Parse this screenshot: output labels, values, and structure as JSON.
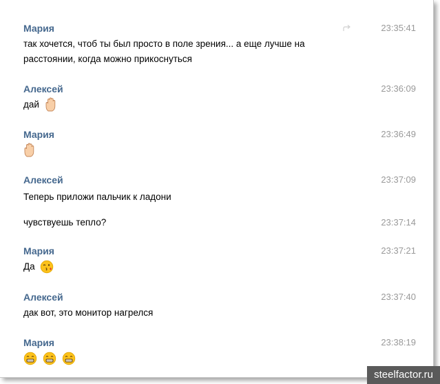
{
  "messages": [
    {
      "author": "Мария",
      "time": "23:35:41",
      "lines": [
        "так хочется, чтоб ты был просто в поле зрения... а еще лучше на",
        "расстоянии, когда можно прикоснуться"
      ],
      "emoji": []
    },
    {
      "author": "Алексей",
      "time": "23:36:09",
      "lines": [
        "дай"
      ],
      "emoji": [
        "raised-hand"
      ]
    },
    {
      "author": "Мария",
      "time": "23:36:49",
      "lines": [],
      "emoji": [
        "raised-hand"
      ]
    },
    {
      "author": "Алексей",
      "time": "23:37:09",
      "lines": [
        "Теперь приложи пальчик к ладони"
      ],
      "emoji": []
    },
    {
      "author": "",
      "time": "23:37:14",
      "lines": [
        "чувствуешь тепло?"
      ],
      "emoji": []
    },
    {
      "author": "Мария",
      "time": "23:37:21",
      "lines": [
        "Да"
      ],
      "emoji": [
        "kissing-face"
      ]
    },
    {
      "author": "Алексей",
      "time": "23:37:40",
      "lines": [
        "дак вот, это монитор нагрелся"
      ],
      "emoji": []
    },
    {
      "author": "Мария",
      "time": "23:38:19",
      "lines": [],
      "emoji": [
        "grinning-face",
        "grinning-face",
        "grinning-face"
      ]
    }
  ],
  "watermark": "steelfactor.ru",
  "colors": {
    "author": "#45688e",
    "time": "#999999",
    "text": "#000000",
    "watermark_bg": "#5a5a5a"
  }
}
